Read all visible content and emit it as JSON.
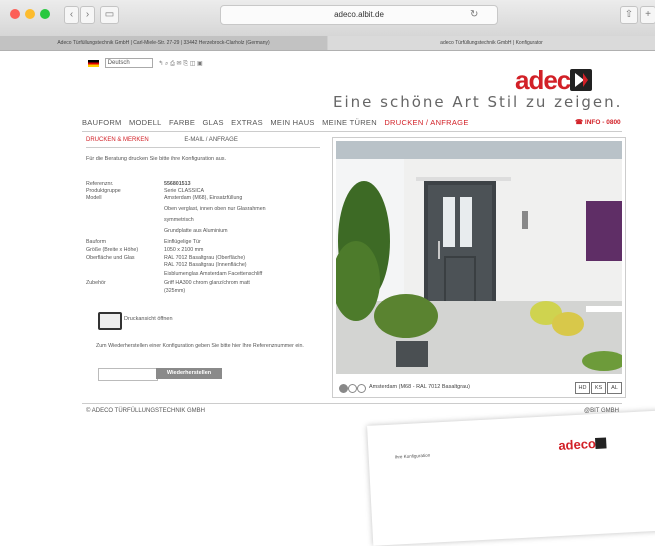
{
  "browser": {
    "url": "adeco.albit.de",
    "tab_left": "Adeco Türfüllungstechnik GmbH | Carl-Miele-Str. 27-29 | 33442 Herzebrock-Clarholz (Germany)",
    "tab_right": "adeco Türfüllungstechnik GmbH | Konfigurator"
  },
  "header": {
    "language": "Deutsch",
    "logo": "adeco",
    "slogan": "Eine schöne Art Stil zu zeigen."
  },
  "menu": {
    "items": [
      "BAUFORM",
      "MODELL",
      "FARBE",
      "GLAS",
      "EXTRAS",
      "MEIN HAUS",
      "MEINE TÜREN",
      "DRUCKEN / ANFRAGE"
    ],
    "info": "INFO - 0800"
  },
  "subtabs": [
    "DRUCKEN & MERKEN",
    "E-MAIL / ANFRAGE"
  ],
  "intro": "Für die Beratung drucken Sie bitte ihre Konfiguration aus.",
  "details": {
    "ref_label": "Referenznr.",
    "ref_value": "556801513",
    "group_label": "Produktgruppe",
    "group_value": "Serie CLASSICA",
    "model_label": "Modell",
    "model_l1": "Amsterdam (M68), Einsatzfüllung",
    "model_l2": "Oben verglast, innen oben nur Glasrahmen",
    "model_l3": "symmetrisch",
    "model_l4": "Grundplatte aus Aluminium",
    "build_label": "Bauform",
    "build_value": "Einflügelige Tür",
    "size_label": "Größe (Breite x Höhe)",
    "size_value": "1050 x 2100 mm",
    "surface_label": "Oberfläche und Glas",
    "surface_l1": "RAL 7012 Basaltgrau (Oberfläche)",
    "surface_l2": "RAL 7012 Basaltgrau (Innenfläche)",
    "surface_l3": "Eisblumenglas Amsterdam Facettenschliff",
    "acc_label": "Zubehör",
    "acc_l1": "Griff HA300 chrom glanz/chrom matt",
    "acc_l2": "(325mm)"
  },
  "print": {
    "label": "Druckansicht öffnen"
  },
  "restore": {
    "text": "Zum Wiederherstellen einer Konfiguration geben Sie bitte hier Ihre Referenznummer ein.",
    "button": "Wiederherstellen",
    "placeholder": ""
  },
  "photo": {
    "caption": "Amsterdam (M68 - RAL 7012 Basaltgrau)",
    "buttons": [
      "HD",
      "KS",
      "AL"
    ]
  },
  "footer": {
    "left": "© ADECO TÜRFÜLLUNGSTECHNIK GMBH",
    "right": "@BIT GMBH"
  },
  "paper": {
    "logo": "adeco",
    "text": "Ihre Konfiguration"
  },
  "colors": {
    "brand": "#d22027",
    "door": "#4c5256"
  }
}
